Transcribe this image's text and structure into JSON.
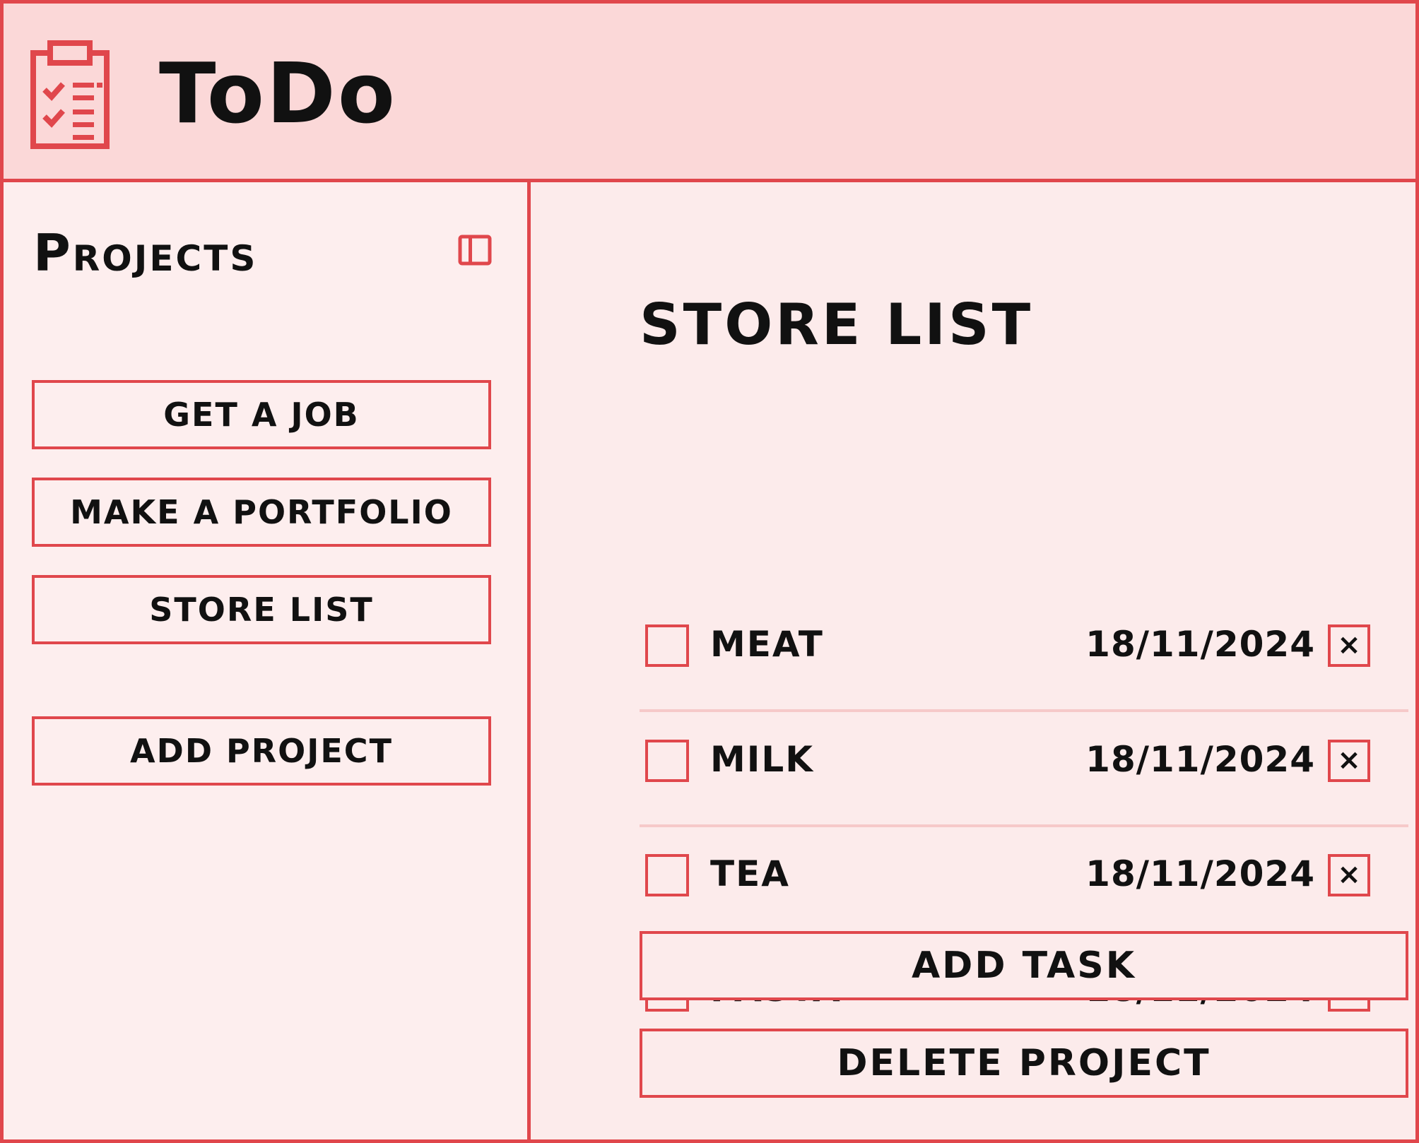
{
  "colors": {
    "accent": "#e0474c",
    "header_bg": "#fbd8d8",
    "sidebar_bg": "#fdeeee",
    "main_bg": "#fcebeb",
    "row_divider": "#f6c9c9",
    "text": "#111111"
  },
  "header": {
    "icon": "clipboard-checklist-icon",
    "title": "ToDo"
  },
  "sidebar": {
    "title": "Projects",
    "toggle_icon": "sidebar-toggle-icon",
    "projects": [
      {
        "label": "Get a Job"
      },
      {
        "label": "Make a Portfolio"
      },
      {
        "label": "Store List"
      }
    ],
    "add_project_label": "Add Project"
  },
  "main": {
    "project_title": "Store List",
    "tasks": [
      {
        "name": "Meat",
        "date": "18/11/2024",
        "delete_label": "×"
      },
      {
        "name": "Milk",
        "date": "18/11/2024",
        "delete_label": "×"
      },
      {
        "name": "Tea",
        "date": "18/11/2024",
        "delete_label": "×"
      },
      {
        "name": "Pasta",
        "date": "18/11/2024",
        "delete_label": "×"
      }
    ],
    "add_task_label": "Add Task",
    "delete_project_label": "Delete Project"
  }
}
